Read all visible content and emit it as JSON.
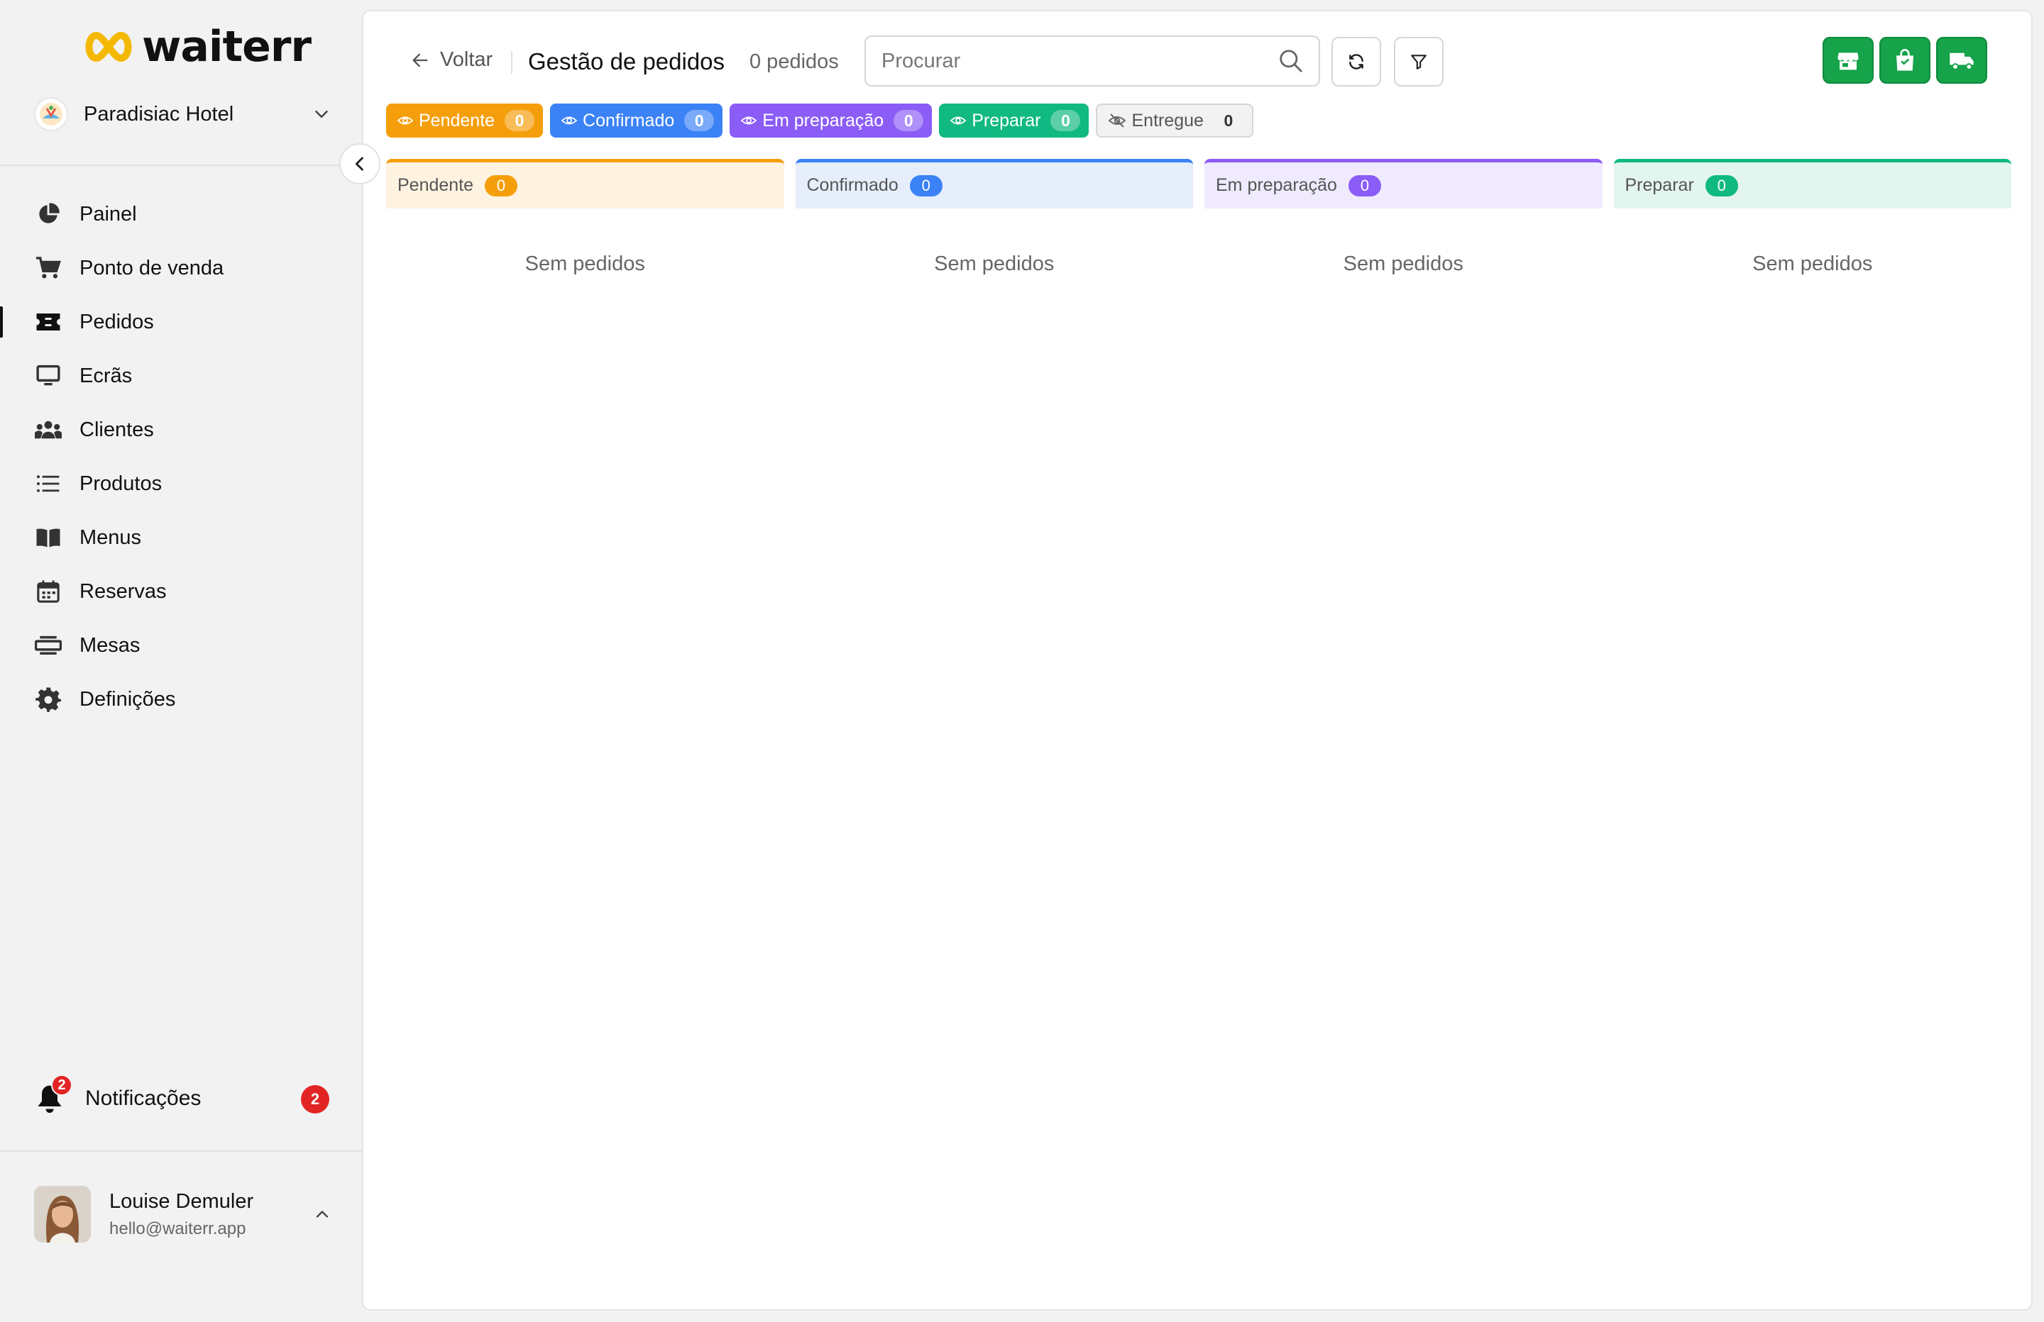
{
  "brand": {
    "name": "waiterr"
  },
  "org": {
    "name": "Paradisiac Hotel"
  },
  "nav": [
    {
      "label": "Painel",
      "icon": "pie-chart-icon"
    },
    {
      "label": "Ponto de venda",
      "icon": "cart-icon"
    },
    {
      "label": "Pedidos",
      "icon": "ticket-icon",
      "active": true
    },
    {
      "label": "Ecrãs",
      "icon": "monitor-icon"
    },
    {
      "label": "Clientes",
      "icon": "users-icon"
    },
    {
      "label": "Produtos",
      "icon": "list-icon"
    },
    {
      "label": "Menus",
      "icon": "book-icon"
    },
    {
      "label": "Reservas",
      "icon": "calendar-icon"
    },
    {
      "label": "Mesas",
      "icon": "table-icon"
    },
    {
      "label": "Definições",
      "icon": "gear-icon"
    }
  ],
  "notifications": {
    "label": "Notificações",
    "count": "2"
  },
  "user": {
    "name": "Louise Demuler",
    "email": "hello@waiterr.app"
  },
  "header": {
    "back_label": "Voltar",
    "title": "Gestão de pedidos",
    "count_label": "0 pedidos",
    "search_placeholder": "Procurar"
  },
  "filters": [
    {
      "label": "Pendente",
      "count": "0",
      "color": "#f59e0b"
    },
    {
      "label": "Confirmado",
      "count": "0",
      "color": "#3b82f6"
    },
    {
      "label": "Em preparação",
      "count": "0",
      "color": "#8b5cf6"
    },
    {
      "label": "Preparar",
      "count": "0",
      "color": "#10b981"
    },
    {
      "label": "Entregue",
      "count": "0",
      "color": "#f2f2f2"
    }
  ],
  "columns": [
    {
      "title": "Pendente",
      "count": "0",
      "empty": "Sem pedidos"
    },
    {
      "title": "Confirmado",
      "count": "0",
      "empty": "Sem pedidos"
    },
    {
      "title": "Em preparação",
      "count": "0",
      "empty": "Sem pedidos"
    },
    {
      "title": "Preparar",
      "count": "0",
      "empty": "Sem pedidos"
    }
  ],
  "colors": {
    "accent_green": "#16a34a",
    "danger": "#e32424"
  }
}
